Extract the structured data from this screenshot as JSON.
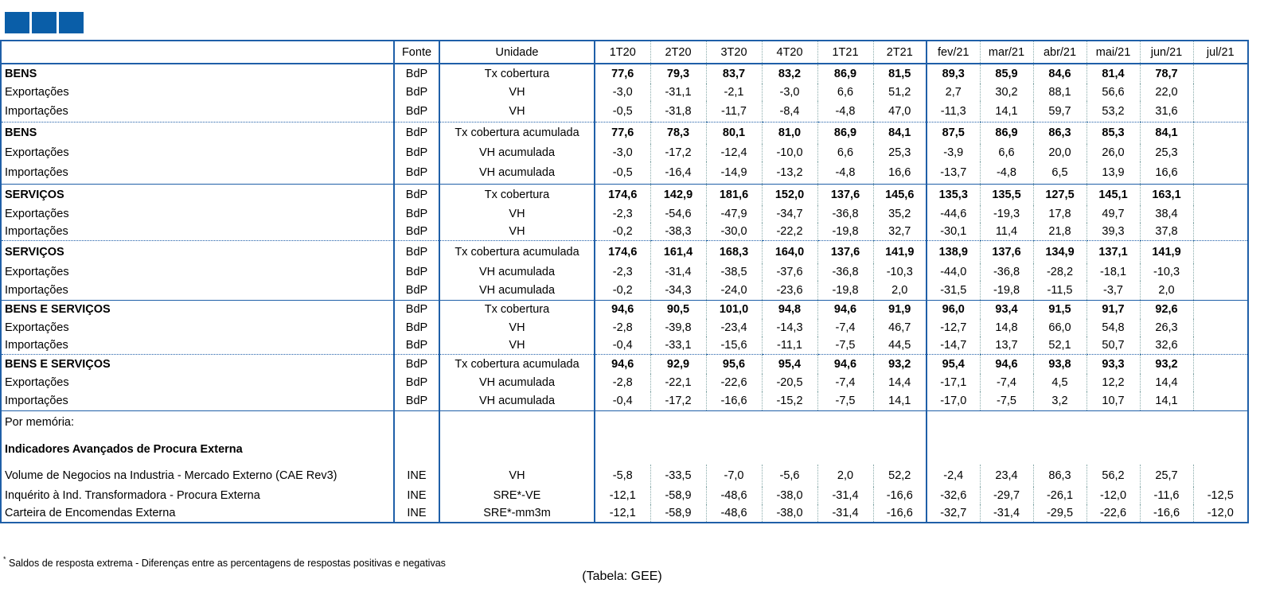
{
  "header": {
    "fonte": "Fonte",
    "unidade": "Unidade",
    "quarters": [
      "1T20",
      "2T20",
      "3T20",
      "4T20",
      "1T21",
      "2T21"
    ],
    "months": [
      "fev/21",
      "mar/21",
      "abr/21",
      "mai/21",
      "jun/21",
      "jul/21"
    ]
  },
  "groups": [
    {
      "rows": [
        {
          "label": "BENS",
          "src": "BdP",
          "unit": "Tx cobertura",
          "bold": true,
          "values": [
            "77,6",
            "79,3",
            "83,7",
            "83,2",
            "86,9",
            "81,5",
            "89,3",
            "85,9",
            "84,6",
            "81,4",
            "78,7",
            ""
          ]
        },
        {
          "label": "Exportações",
          "src": "BdP",
          "unit": "VH",
          "values": [
            "-3,0",
            "-31,1",
            "-2,1",
            "-3,0",
            "6,6",
            "51,2",
            "2,7",
            "30,2",
            "88,1",
            "56,6",
            "22,0",
            ""
          ]
        },
        {
          "label": "Importações",
          "src": "BdP",
          "unit": "VH",
          "values": [
            "-0,5",
            "-31,8",
            "-11,7",
            "-8,4",
            "-4,8",
            "47,0",
            "-11,3",
            "14,1",
            "59,7",
            "53,2",
            "31,6",
            ""
          ]
        }
      ],
      "sep": "dot"
    },
    {
      "rows": [
        {
          "label": "BENS",
          "src": "BdP",
          "unit": "Tx cobertura acumulada",
          "bold": true,
          "values": [
            "77,6",
            "78,3",
            "80,1",
            "81,0",
            "86,9",
            "84,1",
            "87,5",
            "86,9",
            "86,3",
            "85,3",
            "84,1",
            ""
          ]
        },
        {
          "label": "Exportações",
          "src": "BdP",
          "unit": "VH acumulada",
          "values": [
            "-3,0",
            "-17,2",
            "-12,4",
            "-10,0",
            "6,6",
            "25,3",
            "-3,9",
            "6,6",
            "20,0",
            "26,0",
            "25,3",
            ""
          ]
        },
        {
          "label": "Importações",
          "src": "BdP",
          "unit": "VH acumulada",
          "values": [
            "-0,5",
            "-16,4",
            "-14,9",
            "-13,2",
            "-4,8",
            "16,6",
            "-13,7",
            "-4,8",
            "6,5",
            "13,9",
            "16,6",
            ""
          ]
        }
      ],
      "sep": "line"
    },
    {
      "rows": [
        {
          "label": "SERVIÇOS",
          "src": "BdP",
          "unit": "Tx cobertura",
          "bold": true,
          "values": [
            "174,6",
            "142,9",
            "181,6",
            "152,0",
            "137,6",
            "145,6",
            "135,3",
            "135,5",
            "127,5",
            "145,1",
            "163,1",
            ""
          ]
        },
        {
          "label": "Exportações",
          "src": "BdP",
          "unit": "VH",
          "values": [
            "-2,3",
            "-54,6",
            "-47,9",
            "-34,7",
            "-36,8",
            "35,2",
            "-44,6",
            "-19,3",
            "17,8",
            "49,7",
            "38,4",
            ""
          ]
        },
        {
          "label": "Importações",
          "src": "BdP",
          "unit": "VH",
          "values": [
            "-0,2",
            "-38,3",
            "-30,0",
            "-22,2",
            "-19,8",
            "32,7",
            "-30,1",
            "11,4",
            "21,8",
            "39,3",
            "37,8",
            ""
          ]
        }
      ],
      "sep": "dot"
    },
    {
      "rows": [
        {
          "label": "SERVIÇOS",
          "src": "BdP",
          "unit": "Tx cobertura acumulada",
          "bold": true,
          "values": [
            "174,6",
            "161,4",
            "168,3",
            "164,0",
            "137,6",
            "141,9",
            "138,9",
            "137,6",
            "134,9",
            "137,1",
            "141,9",
            ""
          ]
        },
        {
          "label": "Exportações",
          "src": "BdP",
          "unit": "VH acumulada",
          "values": [
            "-2,3",
            "-31,4",
            "-38,5",
            "-37,6",
            "-36,8",
            "-10,3",
            "-44,0",
            "-36,8",
            "-28,2",
            "-18,1",
            "-10,3",
            ""
          ]
        },
        {
          "label": "Importações",
          "src": "BdP",
          "unit": "VH acumulada",
          "values": [
            "-0,2",
            "-34,3",
            "-24,0",
            "-23,6",
            "-19,8",
            "2,0",
            "-31,5",
            "-19,8",
            "-11,5",
            "-3,7",
            "2,0",
            ""
          ]
        }
      ],
      "sep": "line"
    },
    {
      "rows": [
        {
          "label": "BENS E SERVIÇOS",
          "src": "BdP",
          "unit": "Tx cobertura",
          "bold": true,
          "values": [
            "94,6",
            "90,5",
            "101,0",
            "94,8",
            "94,6",
            "91,9",
            "96,0",
            "93,4",
            "91,5",
            "91,7",
            "92,6",
            ""
          ]
        },
        {
          "label": "Exportações",
          "src": "BdP",
          "unit": "VH",
          "values": [
            "-2,8",
            "-39,8",
            "-23,4",
            "-14,3",
            "-7,4",
            "46,7",
            "-12,7",
            "14,8",
            "66,0",
            "54,8",
            "26,3",
            ""
          ]
        },
        {
          "label": "Importações",
          "src": "BdP",
          "unit": "VH",
          "values": [
            "-0,4",
            "-33,1",
            "-15,6",
            "-11,1",
            "-7,5",
            "44,5",
            "-14,7",
            "13,7",
            "52,1",
            "50,7",
            "32,6",
            ""
          ]
        }
      ],
      "sep": "dot"
    },
    {
      "rows": [
        {
          "label": "BENS E SERVIÇOS",
          "src": "BdP",
          "unit": "Tx cobertura acumulada",
          "bold": true,
          "values": [
            "94,6",
            "92,9",
            "95,6",
            "95,4",
            "94,6",
            "93,2",
            "95,4",
            "94,6",
            "93,8",
            "93,3",
            "93,2",
            ""
          ]
        },
        {
          "label": "Exportações",
          "src": "BdP",
          "unit": "VH acumulada",
          "values": [
            "-2,8",
            "-22,1",
            "-22,6",
            "-20,5",
            "-7,4",
            "14,4",
            "-17,1",
            "-7,4",
            "4,5",
            "12,2",
            "14,4",
            ""
          ]
        },
        {
          "label": "Importações",
          "src": "BdP",
          "unit": "VH acumulada",
          "values": [
            "-0,4",
            "-17,2",
            "-16,6",
            "-15,2",
            "-7,5",
            "14,1",
            "-17,0",
            "-7,5",
            "3,2",
            "10,7",
            "14,1",
            ""
          ]
        }
      ],
      "sep": "line"
    }
  ],
  "memo": {
    "title": "Por memória:",
    "subtitle": "Indicadores Avançados de Procura Externa",
    "rows": [
      {
        "label": "Volume de Negocios na Industria - Mercado Externo (CAE Rev3)",
        "src": "INE",
        "unit": "VH",
        "values": [
          "-5,8",
          "-33,5",
          "-7,0",
          "-5,6",
          "2,0",
          "52,2",
          "-2,4",
          "23,4",
          "86,3",
          "56,2",
          "25,7",
          ""
        ]
      },
      {
        "label": "Inquérito à Ind. Transformadora - Procura Externa",
        "src": "INE",
        "unit": "SRE*-VE",
        "values": [
          "-12,1",
          "-58,9",
          "-48,6",
          "-38,0",
          "-31,4",
          "-16,6",
          "-32,6",
          "-29,7",
          "-26,1",
          "-12,0",
          "-11,6",
          "-12,5"
        ]
      },
      {
        "label": "Carteira de Encomendas Externa",
        "src": "INE",
        "unit": "SRE*-mm3m",
        "values": [
          "-12,1",
          "-58,9",
          "-48,6",
          "-38,0",
          "-31,4",
          "-16,6",
          "-32,7",
          "-31,4",
          "-29,5",
          "-22,6",
          "-16,6",
          "-12,0"
        ]
      }
    ]
  },
  "footnote": "Saldos de resposta extrema - Diferenças entre as percentagens de respostas positivas e negativas",
  "footnote_mark": "*",
  "source": "(Tabela: GEE)"
}
